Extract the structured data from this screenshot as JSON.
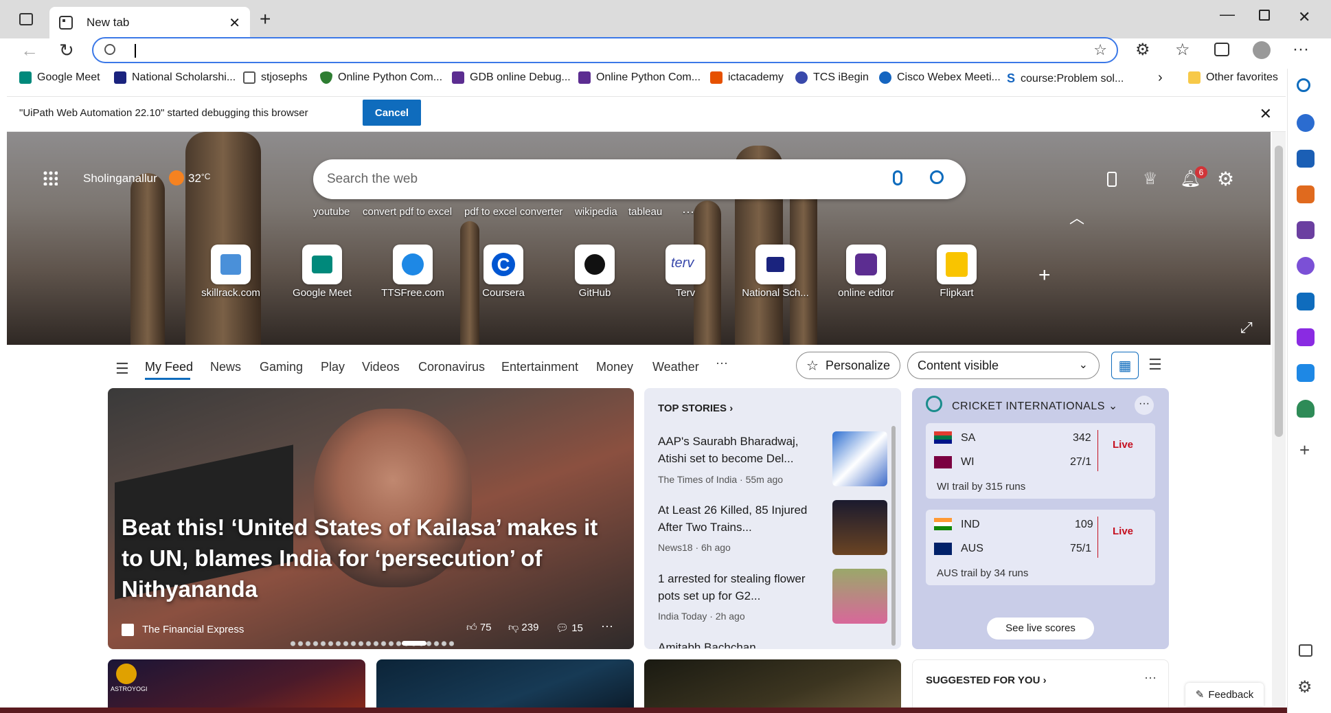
{
  "browser": {
    "tab_title": "New tab",
    "new_tab_symbol": "+",
    "favorites": [
      {
        "label": "Google Meet",
        "icon": "google-meet-icon",
        "color": "#00897b"
      },
      {
        "label": "National Scholarshi...",
        "icon": "scholarship-icon",
        "color": "#1a237e"
      },
      {
        "label": "stjosephs",
        "icon": "document-icon",
        "color": "#555555"
      },
      {
        "label": "Online Python Com...",
        "icon": "shield-icon",
        "color": "#2e7d32"
      },
      {
        "label": "GDB online Debug...",
        "icon": "bolt-icon",
        "color": "#5c2d91"
      },
      {
        "label": "Online Python Com...",
        "icon": "bolt-icon",
        "color": "#5c2d91"
      },
      {
        "label": "ictacademy",
        "icon": "ictacademy-icon",
        "color": "#e65100"
      },
      {
        "label": "TCS iBegin",
        "icon": "tcs-icon",
        "color": "#3949ab"
      },
      {
        "label": "Cisco Webex Meeti...",
        "icon": "webex-icon",
        "color": "#1565c0"
      },
      {
        "label": "course:Problem sol...",
        "icon": "s-icon",
        "color": "#1565c0"
      }
    ],
    "other_favorites": "Other favorites"
  },
  "infobar": {
    "message": "\"UiPath Web Automation 22.10\" started debugging this browser",
    "cancel_label": "Cancel"
  },
  "hero": {
    "location": "Sholinganallur",
    "temperature": "32",
    "temp_unit": "°C",
    "search_placeholder": "Search the web",
    "suggestions": [
      "youtube",
      "convert pdf to excel",
      "pdf to excel converter",
      "wikipedia",
      "tableau"
    ],
    "more": "···",
    "notification_count": "6",
    "quick_links": [
      {
        "label": "skillrack.com",
        "icon": "skillrack-icon",
        "color": "#4a90d9"
      },
      {
        "label": "Google Meet",
        "icon": "google-meet-icon",
        "color": "#00897b"
      },
      {
        "label": "TTSFree.com",
        "icon": "ttsfree-icon",
        "color": "#1e88e5"
      },
      {
        "label": "Coursera",
        "icon": "coursera-icon",
        "color": "#0056d2"
      },
      {
        "label": "GitHub",
        "icon": "github-icon",
        "color": "#111111"
      },
      {
        "label": "Terv",
        "icon": "terv-icon",
        "color": "#3949ab"
      },
      {
        "label": "National Sch...",
        "icon": "scholarship-icon",
        "color": "#1a237e"
      },
      {
        "label": "online editor",
        "icon": "bolt-icon",
        "color": "#5c2d91"
      },
      {
        "label": "Flipkart",
        "icon": "flipkart-icon",
        "color": "#f9c400"
      }
    ],
    "quick_link_letters": {
      "terv": "terv",
      "github": "",
      "coursera": "C"
    }
  },
  "feed_nav": {
    "items": [
      "My Feed",
      "News",
      "Gaming",
      "Play",
      "Videos",
      "Coronavirus",
      "Entertainment",
      "Money",
      "Weather"
    ],
    "more": "···",
    "personalize": "Personalize",
    "content_select": "Content visible"
  },
  "hero_story": {
    "headline": "Beat this! ‘United States of Kailasa’ makes it to UN, blames India for ‘persecution’ of Nithyananda",
    "source": "The Financial Express",
    "likes": "75",
    "dislikes": "239",
    "comments": "15",
    "more": "···"
  },
  "top_stories": {
    "heading": "TOP STORIES",
    "items": [
      {
        "title": "AAP's Saurabh Bharadwaj, Atishi set to become Del...",
        "source": "The Times of India · 55m ago"
      },
      {
        "title": "At Least 26 Killed, 85 Injured After Two Trains...",
        "source": "News18 · 6h ago"
      },
      {
        "title": "1 arrested for stealing flower pots set up for G2...",
        "source": "India Today · 2h ago"
      },
      {
        "title": "Amitabh Bachchan...",
        "source": ""
      }
    ]
  },
  "cricket": {
    "heading": "CRICKET INTERNATIONALS",
    "matches": [
      {
        "team1": "SA",
        "score1": "342",
        "team2": "WI",
        "score2": "27/1",
        "status": "Live",
        "summary": "WI trail by 315 runs"
      },
      {
        "team1": "IND",
        "score1": "109",
        "team2": "AUS",
        "score2": "75/1",
        "status": "Live",
        "summary": "AUS trail by 34 runs"
      }
    ],
    "see_scores": "See live scores"
  },
  "suggested": {
    "heading": "SUGGESTED FOR YOU",
    "astro_label": "ASTROYOGI"
  },
  "feedback": "Feedback"
}
